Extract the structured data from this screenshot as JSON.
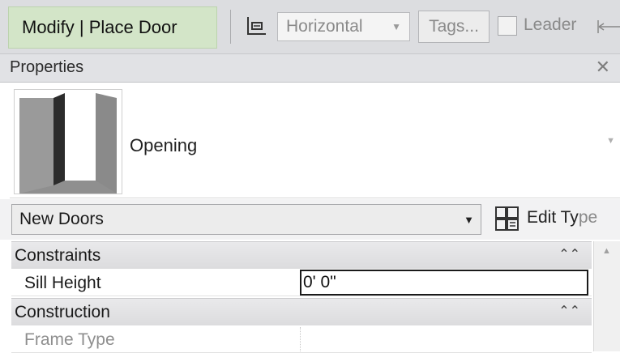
{
  "options_bar": {
    "mode_title": "Modify | Place Door",
    "orientation": {
      "selected": "Horizontal"
    },
    "tags_button": "Tags...",
    "leader": {
      "label": "Leader",
      "checked": false
    }
  },
  "properties": {
    "title": "Properties",
    "type_preview": {
      "name": "Opening"
    },
    "type_selector": {
      "value": "New Doors"
    },
    "edit_type": {
      "label_main": "Edit Ty",
      "label_faded": "pe"
    },
    "groups": [
      {
        "name": "Constraints",
        "params": [
          {
            "name": "Sill Height",
            "value": "0'  0\""
          }
        ]
      },
      {
        "name": "Construction",
        "params": [
          {
            "name": "Frame Type",
            "value": ""
          }
        ]
      }
    ]
  }
}
